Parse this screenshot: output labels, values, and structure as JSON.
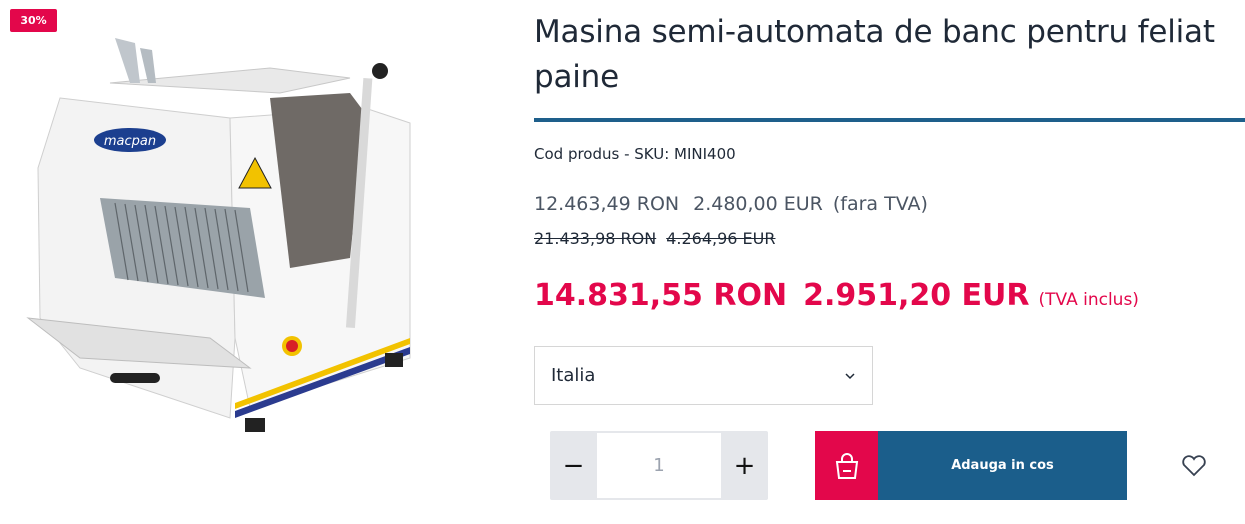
{
  "badge": {
    "text": "30%"
  },
  "product": {
    "image_alt": "macpan bread slicer",
    "title": "Masina semi-automata de banc pentru feliat paine",
    "sku": "Cod produs - SKU: MINI400"
  },
  "prices": {
    "ex_vat_ron": "12.463,49 RON",
    "ex_vat_eur": "2.480,00 EUR",
    "ex_vat_note": "(fara TVA)",
    "old_ron": "21.433,98 RON",
    "old_eur": "4.264,96 EUR",
    "main_ron": "14.831,55 RON",
    "main_eur": "2.951,20 EUR",
    "vat_note": "(TVA inclus)"
  },
  "origin_select": {
    "selected": "Italia"
  },
  "quantity": {
    "value": "1",
    "minus": "−",
    "plus": "+"
  },
  "cart": {
    "label": "Adauga in cos"
  },
  "colors": {
    "accent": "#e3074b",
    "brand": "#1b5e8b",
    "divider": "#1e5f8b"
  }
}
